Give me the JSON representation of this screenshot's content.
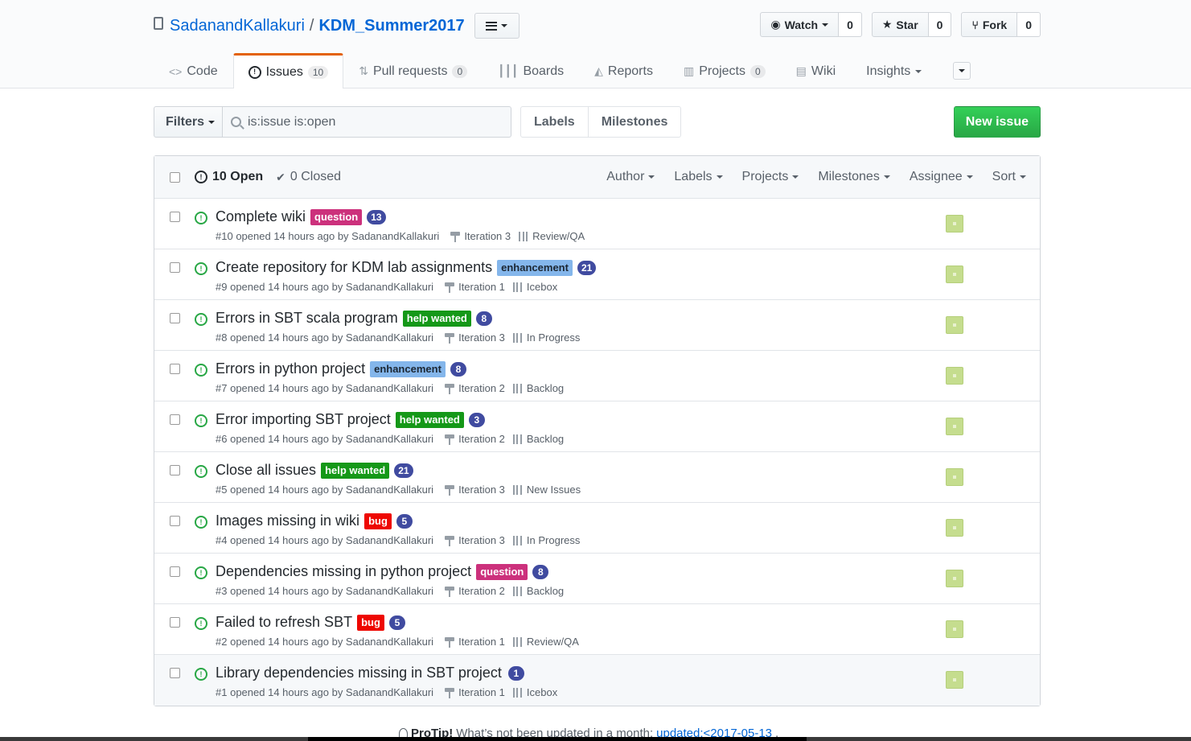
{
  "repo": {
    "owner": "SadanandKallakuri",
    "separator": "/",
    "name": "KDM_Summer2017"
  },
  "pagehead_actions": [
    {
      "label": "Watch",
      "count": "0",
      "icon": "eye-icon",
      "caret": true
    },
    {
      "label": "Star",
      "count": "0",
      "icon": "star-icon",
      "caret": false
    },
    {
      "label": "Fork",
      "count": "0",
      "icon": "fork-icon",
      "caret": false
    }
  ],
  "tabs": [
    {
      "label": "Code",
      "icon": "code-icon",
      "badge": ""
    },
    {
      "label": "Issues",
      "icon": "issue-icon",
      "badge": "10",
      "selected": true
    },
    {
      "label": "Pull requests",
      "icon": "pull-request-icon",
      "badge": "0"
    },
    {
      "label": "Boards",
      "icon": "boards-icon",
      "badge": ""
    },
    {
      "label": "Reports",
      "icon": "reports-icon",
      "badge": ""
    },
    {
      "label": "Projects",
      "icon": "project-icon",
      "badge": "0"
    },
    {
      "label": "Wiki",
      "icon": "wiki-icon",
      "badge": ""
    },
    {
      "label": "Insights",
      "icon": "",
      "badge": "",
      "caret": true
    }
  ],
  "subnav": {
    "filters_label": "Filters",
    "search_value": "is:issue is:open",
    "labels_label": "Labels",
    "milestones_label": "Milestones",
    "new_issue_label": "New issue"
  },
  "list_header": {
    "open_label": "10 Open",
    "closed_label": "0 Closed",
    "menus": [
      "Author",
      "Labels",
      "Projects",
      "Milestones",
      "Assignee",
      "Sort"
    ]
  },
  "issues": [
    {
      "title": "Complete wiki",
      "label": "question",
      "label_color": "#cc317c",
      "estimate": "13",
      "number": "#10",
      "opened": "opened 14 hours ago by SadanandKallakuri",
      "milestone": "Iteration 3",
      "column": "Review/QA"
    },
    {
      "title": "Create repository for KDM lab assignments",
      "label": "enhancement",
      "label_color": "#84b6eb",
      "estimate": "21",
      "number": "#9",
      "opened": "opened 14 hours ago by SadanandKallakuri",
      "milestone": "Iteration 1",
      "column": "Icebox"
    },
    {
      "title": "Errors in SBT scala program",
      "label": "help wanted",
      "label_color": "#159818",
      "estimate": "8",
      "number": "#8",
      "opened": "opened 14 hours ago by SadanandKallakuri",
      "milestone": "Iteration 3",
      "column": "In Progress"
    },
    {
      "title": "Errors in python project",
      "label": "enhancement",
      "label_color": "#84b6eb",
      "estimate": "8",
      "number": "#7",
      "opened": "opened 14 hours ago by SadanandKallakuri",
      "milestone": "Iteration 2",
      "column": "Backlog"
    },
    {
      "title": "Error importing SBT project",
      "label": "help wanted",
      "label_color": "#159818",
      "estimate": "3",
      "number": "#6",
      "opened": "opened 14 hours ago by SadanandKallakuri",
      "milestone": "Iteration 2",
      "column": "Backlog"
    },
    {
      "title": "Close all issues",
      "label": "help wanted",
      "label_color": "#159818",
      "estimate": "21",
      "number": "#5",
      "opened": "opened 14 hours ago by SadanandKallakuri",
      "milestone": "Iteration 3",
      "column": "New Issues"
    },
    {
      "title": "Images missing in wiki",
      "label": "bug",
      "label_color": "#ee0701",
      "estimate": "5",
      "number": "#4",
      "opened": "opened 14 hours ago by SadanandKallakuri",
      "milestone": "Iteration 3",
      "column": "In Progress"
    },
    {
      "title": "Dependencies missing in python project",
      "label": "question",
      "label_color": "#cc317c",
      "estimate": "8",
      "number": "#3",
      "opened": "opened 14 hours ago by SadanandKallakuri",
      "milestone": "Iteration 2",
      "column": "Backlog"
    },
    {
      "title": "Failed to refresh SBT",
      "label": "bug",
      "label_color": "#ee0701",
      "estimate": "5",
      "number": "#2",
      "opened": "opened 14 hours ago by SadanandKallakuri",
      "milestone": "Iteration 1",
      "column": "Review/QA"
    },
    {
      "title": "Library dependencies missing in SBT project",
      "label": "",
      "label_color": "",
      "estimate": "1",
      "number": "#1",
      "opened": "opened 14 hours ago by SadanandKallakuri",
      "milestone": "Iteration 1",
      "column": "Icebox"
    }
  ],
  "protip": {
    "lead": "ProTip!",
    "text": "What’s not been updated in a month:",
    "link": "updated:<2017-05-13",
    "tail": "."
  },
  "colors": {
    "accent_tab": "#e36209",
    "open_icon": "#28a745",
    "new_issue": "#28a745",
    "link": "#0366d6",
    "estimate_badge": "#404ba0"
  }
}
